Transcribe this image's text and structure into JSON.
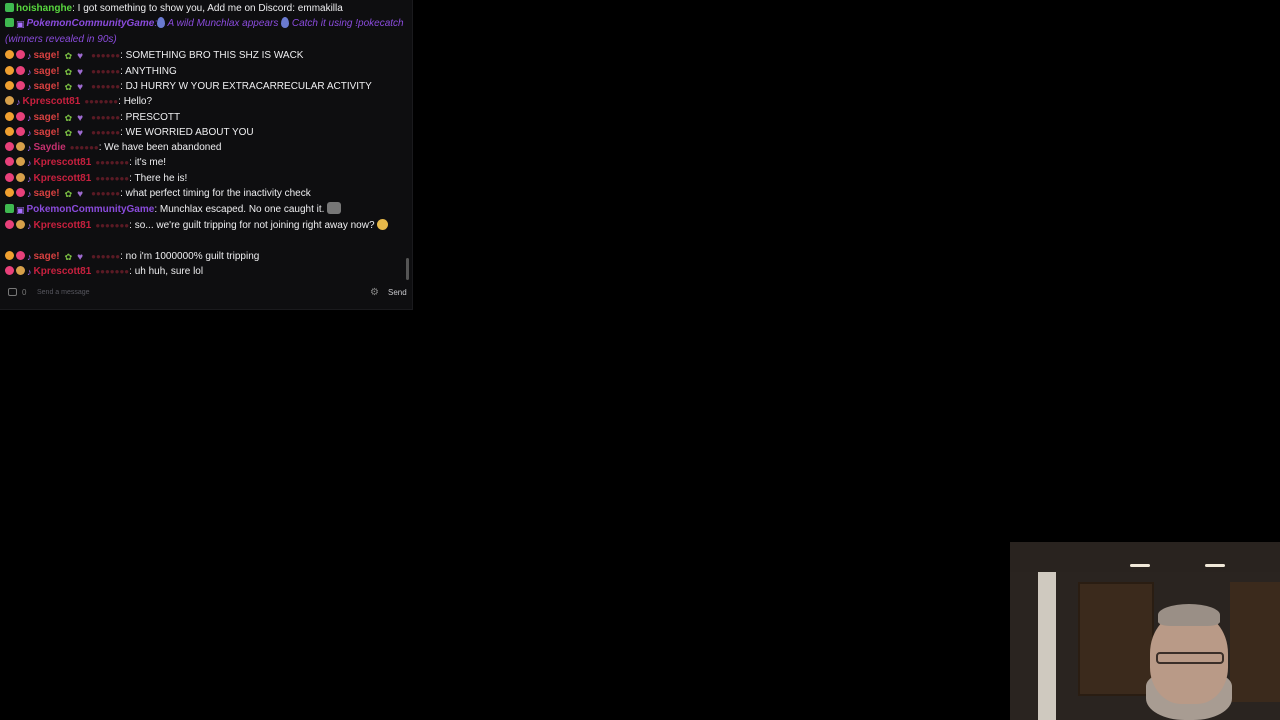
{
  "chat": {
    "messages": [
      {
        "user": "hoishanghe",
        "sep": ":",
        "text": " I got something to show you, Add me on Discord: emmakilla"
      },
      {
        "user": "PokemonCommunityGame",
        "sep": ":",
        "text1": " A wild Munchlax appears ",
        "text2": " Catch it using !pokecatch (winners revealed in 90s)"
      },
      {
        "user": "sage!",
        "sep": ":",
        "text": " SOMETHING BRO THIS SHZ IS WACK"
      },
      {
        "user": "sage!",
        "sep": ":",
        "text": " ANYTHING"
      },
      {
        "user": "sage!",
        "sep": ":",
        "text": " DJ HURRY W YOUR EXTRACARRECULAR ACTIVITY"
      },
      {
        "user": "Kprescott81",
        "sep": ":",
        "text": " Hello?"
      },
      {
        "user": "sage!",
        "sep": ":",
        "text": " PRESCOTT"
      },
      {
        "user": "sage!",
        "sep": ":",
        "text": " WE WORRIED ABOUT YOU"
      },
      {
        "user": "Saydie",
        "sep": ":",
        "text": " We have been abandoned"
      },
      {
        "user": "Kprescott81",
        "sep": ":",
        "text": " it's me!"
      },
      {
        "user": "Kprescott81",
        "sep": ":",
        "text": " There he is!"
      },
      {
        "user": "sage!",
        "sep": ":",
        "text": " what perfect timing for the inactivity check"
      },
      {
        "user": "PokemonCommunityGame",
        "sep": ":",
        "text": " Munchlax escaped. No one caught it."
      },
      {
        "user": "Kprescott81",
        "sep": ":",
        "text": " so... we're guilt tripping for not joining right away now?"
      },
      {
        "user": "sage!",
        "sep": ":",
        "text": " no i'm 1000000% guilt tripping"
      },
      {
        "user": "Kprescott81",
        "sep": ":",
        "text": " uh huh, sure lol"
      }
    ],
    "input": {
      "placeholder": "Send a message",
      "points": "0",
      "send_label": "Send"
    }
  },
  "colors": {
    "chat_bg": "#0e0e10",
    "page_bg": "#000000",
    "accent": "#8a4bdc"
  }
}
